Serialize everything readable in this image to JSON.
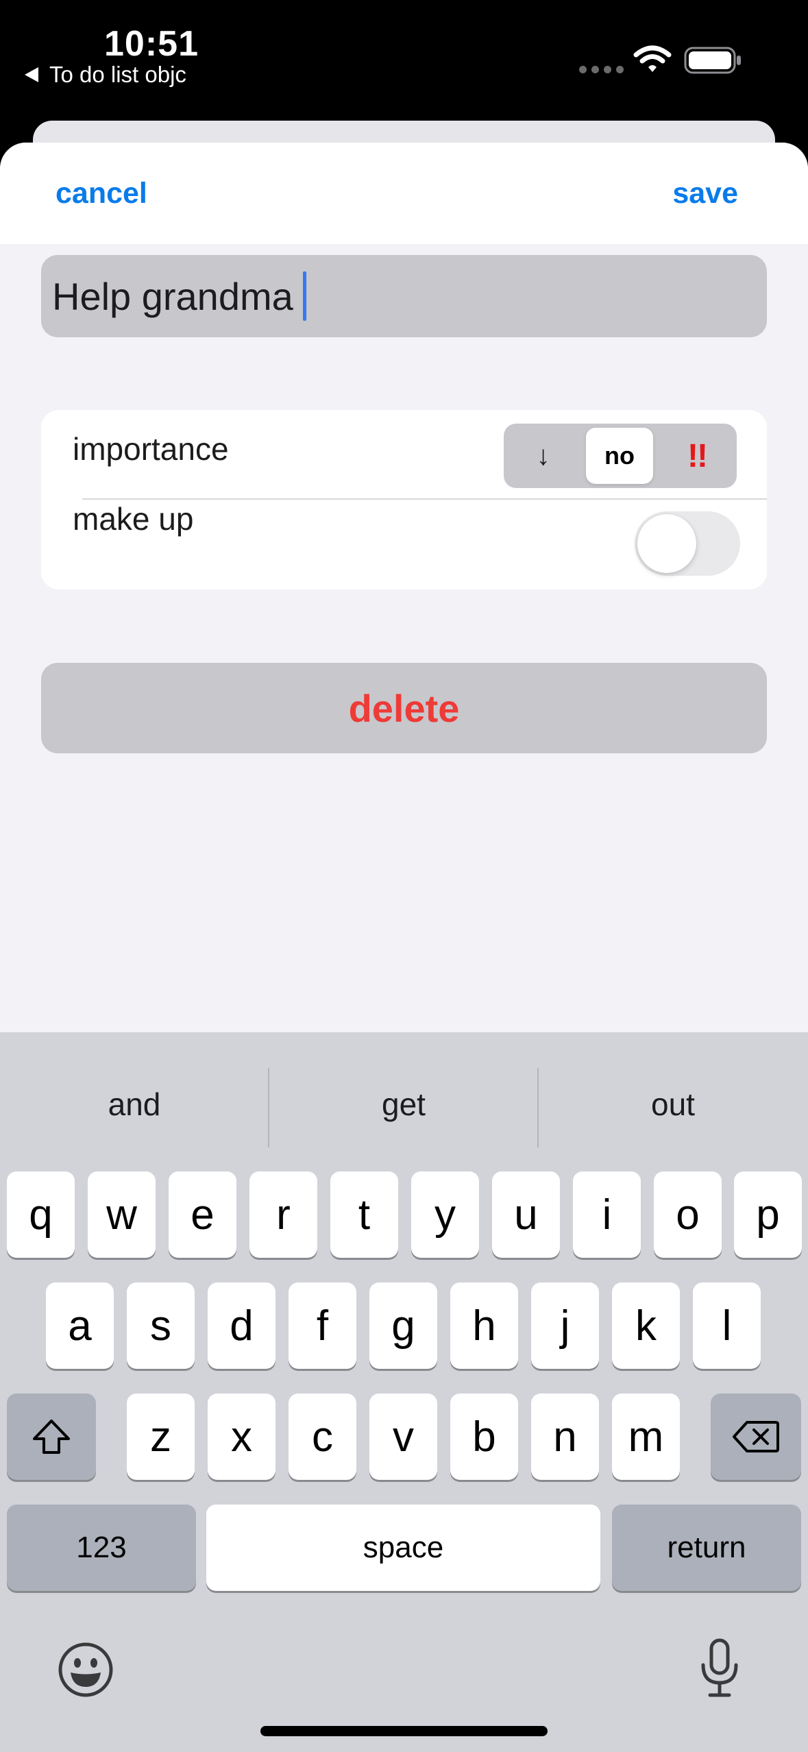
{
  "status_bar": {
    "time": "10:51",
    "back_app_label": "To do list objc"
  },
  "nav": {
    "cancel_label": "cancel",
    "save_label": "save"
  },
  "task": {
    "title_value": "Help grandma"
  },
  "settings": {
    "importance_label": "importance",
    "importance_options": [
      "↓",
      "no",
      "!!"
    ],
    "importance_selected": "no",
    "makeup_label": "make up",
    "makeup_enabled": false
  },
  "delete_label": "delete",
  "keyboard": {
    "predictions": [
      "and",
      "get",
      "out"
    ],
    "row1": [
      "q",
      "w",
      "e",
      "r",
      "t",
      "y",
      "u",
      "i",
      "o",
      "p"
    ],
    "row2": [
      "a",
      "s",
      "d",
      "f",
      "g",
      "h",
      "j",
      "k",
      "l"
    ],
    "row3": [
      "z",
      "x",
      "c",
      "v",
      "b",
      "n",
      "m"
    ],
    "numbers_label": "123",
    "space_label": "space",
    "return_label": "return"
  },
  "colors": {
    "accent": "#0a7bea",
    "destructive": "#ee3b36",
    "high_priority": "#e6171a"
  },
  "icons": [
    "back-arrow-icon",
    "wifi-icon",
    "battery-icon",
    "shift-icon",
    "delete-key-icon",
    "emoji-icon",
    "mic-icon"
  ]
}
